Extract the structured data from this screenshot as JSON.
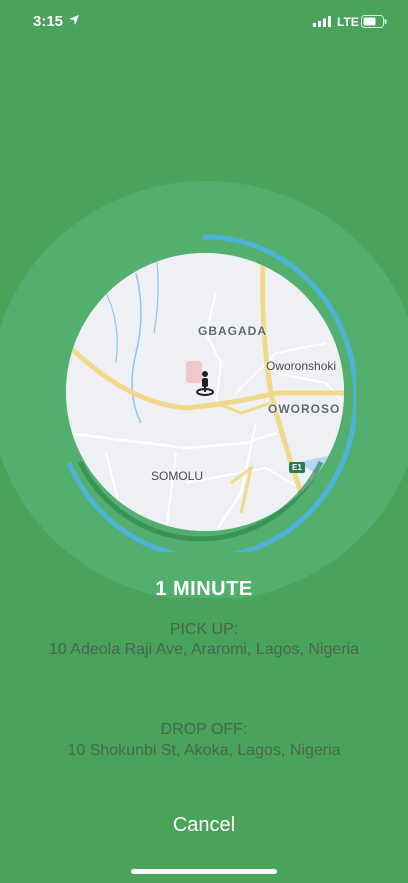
{
  "status_bar": {
    "time": "3:15",
    "network": "LTE",
    "icons": [
      "location-arrow-icon",
      "signal-icon",
      "battery-icon"
    ]
  },
  "map": {
    "labels": {
      "area1": "GBAGADA",
      "area2": "Oworonshoki",
      "area3": "OWOROSO",
      "area4": "SOMOLU"
    },
    "route_badge": "E1",
    "marker": "person-pin-icon"
  },
  "trip": {
    "eta": "1 MINUTE",
    "pickup_label": "PICK UP:",
    "pickup_address": "10 Adeola Raji Ave, Araromi, Lagos, Nigeria",
    "dropoff_label": "DROP OFF:",
    "dropoff_address": "10 Shokunbi St, Akoka, Lagos, Nigeria",
    "progress_fraction": 0.6
  },
  "actions": {
    "cancel_label": "Cancel"
  },
  "colors": {
    "background": "#4aa35a",
    "outer_circle": "#55b375",
    "progress": "#4fb3d9",
    "text_muted": "#486650"
  }
}
